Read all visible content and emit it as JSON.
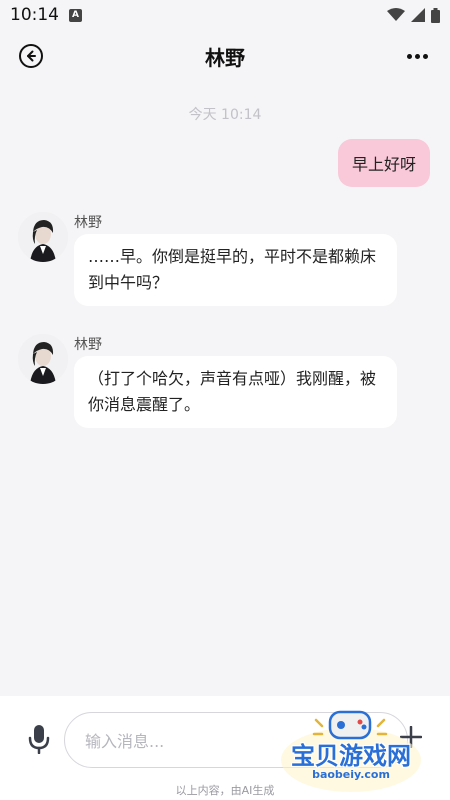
{
  "status_bar": {
    "time": "10:14",
    "notification_icon": "a-badge-icon",
    "icons": [
      "wifi-icon",
      "signal-icon",
      "battery-icon"
    ]
  },
  "header": {
    "title": "林野",
    "back_icon": "back-circle-icon",
    "more_icon": "more-dots-icon"
  },
  "chat": {
    "timestamp": "今天 10:14",
    "user_message": "早上好呀",
    "bot_messages": [
      {
        "name": "林野",
        "text": "……早。你倒是挺早的，平时不是都赖床到中午吗？"
      },
      {
        "name": "林野",
        "text": "（打了个哈欠，声音有点哑）我刚醒，被你消息震醒了。"
      }
    ]
  },
  "input_bar": {
    "placeholder": "输入消息...",
    "value": "",
    "mic_icon": "microphone-icon",
    "plus_icon": "plus-icon",
    "ai_note": "以上内容，由AI生成"
  },
  "watermark": {
    "text": "宝贝游戏网",
    "domain": "baobeiy.com"
  },
  "colors": {
    "background": "#f5f5f7",
    "user_bubble": "#f9c8d9",
    "bot_bubble": "#ffffff",
    "watermark": "#2a6fd6"
  }
}
